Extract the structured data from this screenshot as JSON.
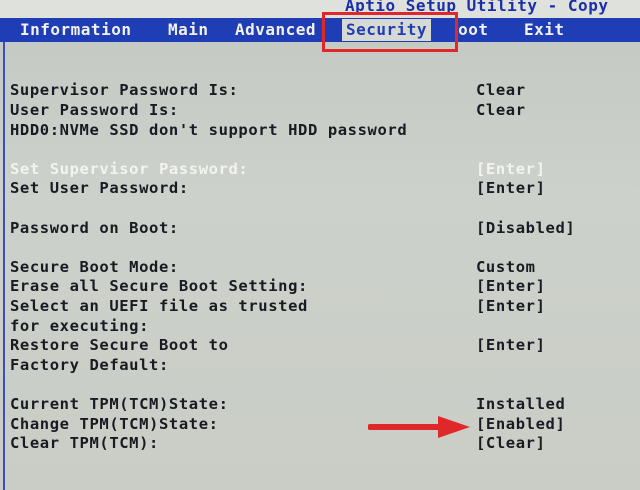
{
  "title": "Aptio Setup Utility - Copy",
  "menu": {
    "information": "Information",
    "main": "Main",
    "advanced": "Advanced",
    "security": "Security",
    "boot": "Boot",
    "exit": "Exit"
  },
  "rows": {
    "supervisor_pw_status": {
      "label": "Supervisor Password Is:",
      "value": "Clear"
    },
    "user_pw_status": {
      "label": "User Password Is:",
      "value": "Clear"
    },
    "hdd_note": "HDD0:NVMe SSD don't support HDD password",
    "set_supervisor_pw": {
      "label": "Set Supervisor Password:",
      "value": "[Enter]"
    },
    "set_user_pw": {
      "label": "Set User Password:",
      "value": "[Enter]"
    },
    "password_on_boot": {
      "label": "Password on Boot:",
      "value": "[Disabled]"
    },
    "secure_boot_mode": {
      "label": "Secure Boot Mode:",
      "value": "Custom"
    },
    "erase_secure_boot": {
      "label": "Erase all Secure Boot Setting:",
      "value": "[Enter]"
    },
    "select_uefi_file": {
      "label_line1": "Select an UEFI file as trusted",
      "label_line2": "for executing:",
      "value": "[Enter]"
    },
    "restore_secure_boot": {
      "label_line1": "Restore Secure Boot to",
      "label_line2": "Factory Default:",
      "value": "[Enter]"
    },
    "current_tpm_state": {
      "label": "Current TPM(TCM)State:",
      "value": "Installed"
    },
    "change_tpm_state": {
      "label": "Change TPM(TCM)State:",
      "value": "[Enabled]"
    },
    "clear_tpm": {
      "label": "Clear TPM(TCM):",
      "value": "[Clear]"
    }
  },
  "colors": {
    "menubar": "#1f3db4",
    "title": "#1c2fa8",
    "highlight_box": "#e0282a",
    "arrow": "#e0282a",
    "text": "#1a1a22",
    "selected_text": "#f4f4ee"
  }
}
